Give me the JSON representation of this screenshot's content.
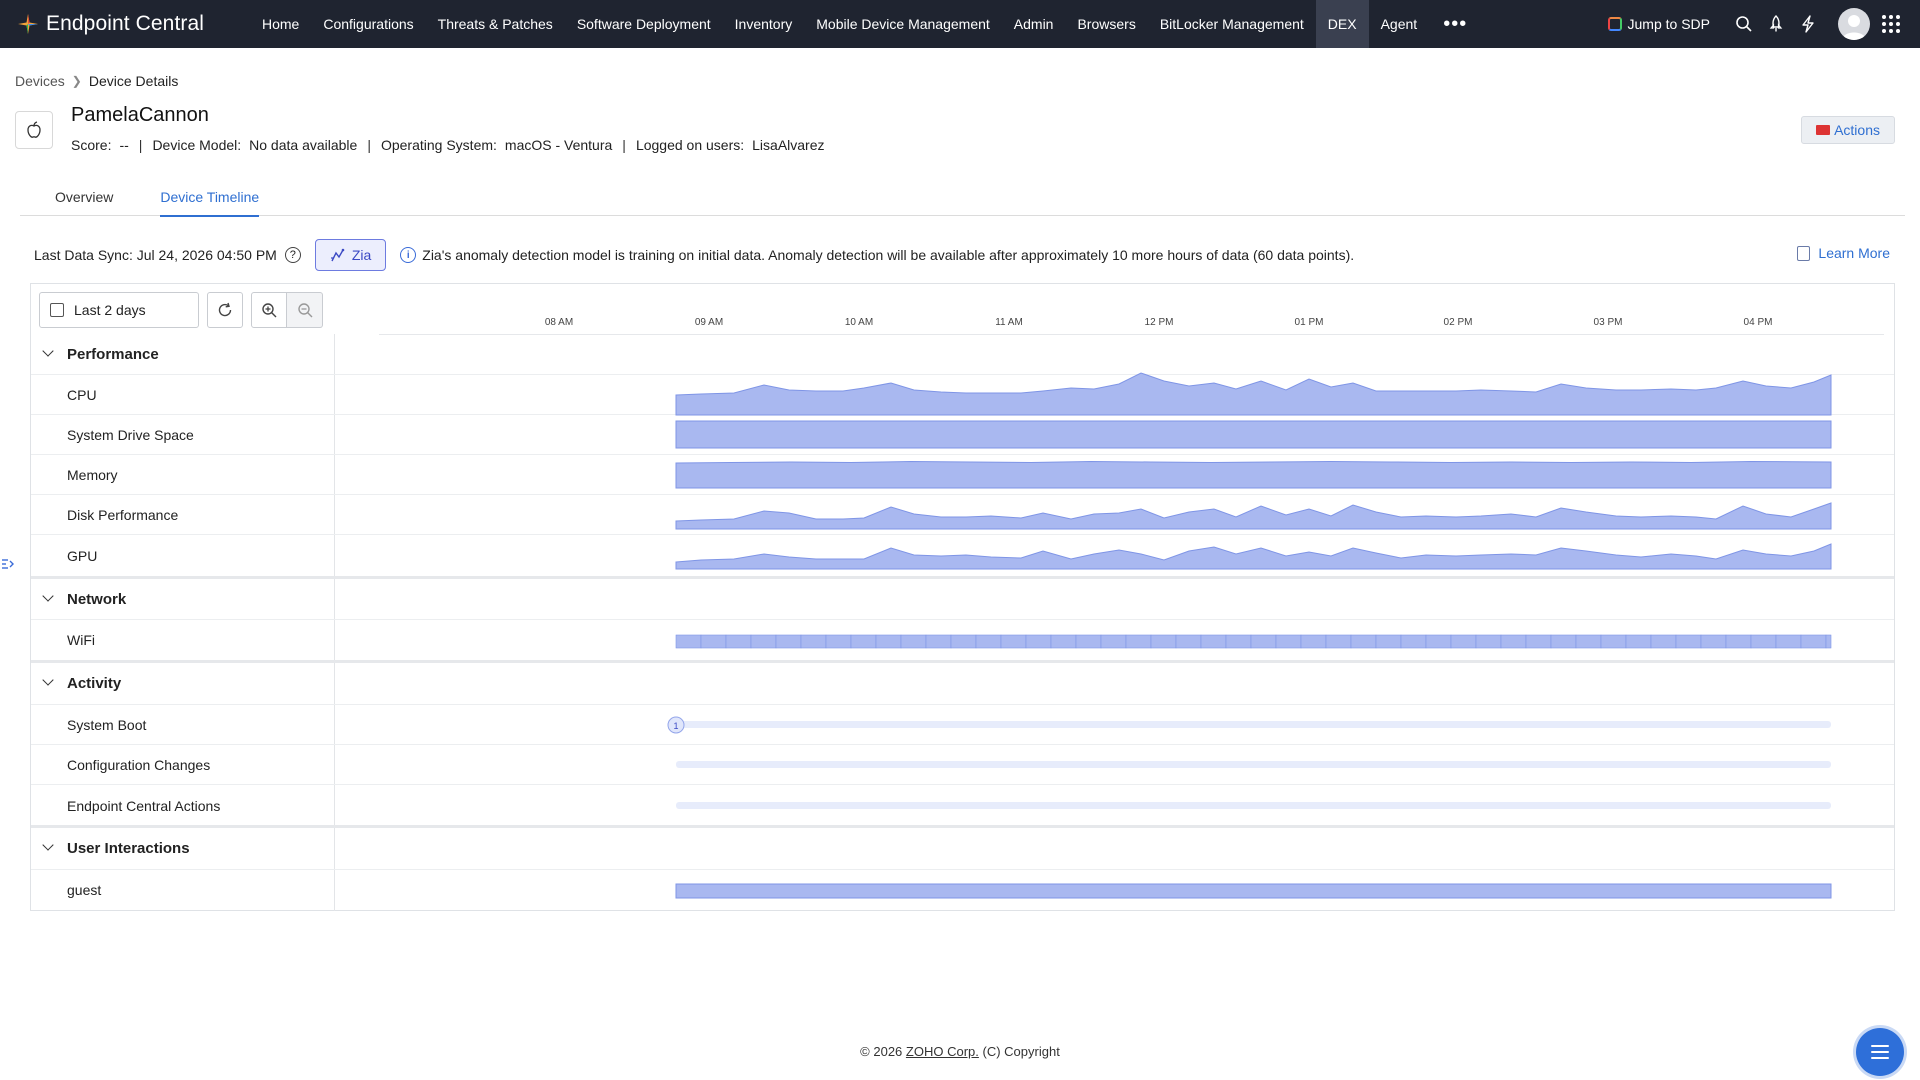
{
  "app": {
    "title": "Endpoint Central",
    "nav": [
      "Home",
      "Configurations",
      "Threats & Patches",
      "Software Deployment",
      "Inventory",
      "Mobile Device Management",
      "Admin",
      "Browsers",
      "BitLocker Management",
      "DEX",
      "Agent"
    ],
    "active_nav": "DEX",
    "jump_label": "Jump to SDP"
  },
  "breadcrumb": {
    "parent": "Devices",
    "current": "Device Details"
  },
  "device": {
    "name": "PamelaCannon",
    "score_label": "Score:",
    "score": "--",
    "model_label": "Device Model:",
    "model": "No data available",
    "os_label": "Operating System:",
    "os": "macOS - Ventura",
    "users_label": "Logged on users:",
    "users": "LisaAlvarez",
    "actions_label": "Actions"
  },
  "tabs": {
    "overview": "Overview",
    "timeline": "Device Timeline"
  },
  "sync": {
    "text": "Last Data Sync: Jul 24, 2026 04:50 PM",
    "zia_label": "Zia",
    "zia_message": "Zia's anomaly detection model is training on initial data. Anomaly detection will be available after approximately 10 more hours of data (60 data points).",
    "learn_more": "Learn More"
  },
  "timeline": {
    "range": "Last 2 days",
    "ticks": [
      "08 AM",
      "09 AM",
      "10 AM",
      "11 AM",
      "12 PM",
      "01 PM",
      "02 PM",
      "03 PM",
      "04 PM"
    ],
    "groups": {
      "performance": "Performance",
      "network": "Network",
      "activity": "Activity",
      "user_interactions": "User Interactions"
    },
    "rows": {
      "cpu": "CPU",
      "drive": "System Drive Space",
      "memory": "Memory",
      "disk": "Disk Performance",
      "gpu": "GPU",
      "wifi": "WiFi",
      "boot": "System Boot",
      "config": "Configuration Changes",
      "ec_actions": "Endpoint Central Actions",
      "guest": "guest"
    },
    "boot_count": "1",
    "colors": {
      "fill": "#a9b8f0",
      "stroke": "#7f95e6",
      "track": "#e7ecfb"
    }
  },
  "footer": {
    "prefix": "© 2026",
    "company": "ZOHO Corp.",
    "suffix": "(C) Copyright"
  }
}
